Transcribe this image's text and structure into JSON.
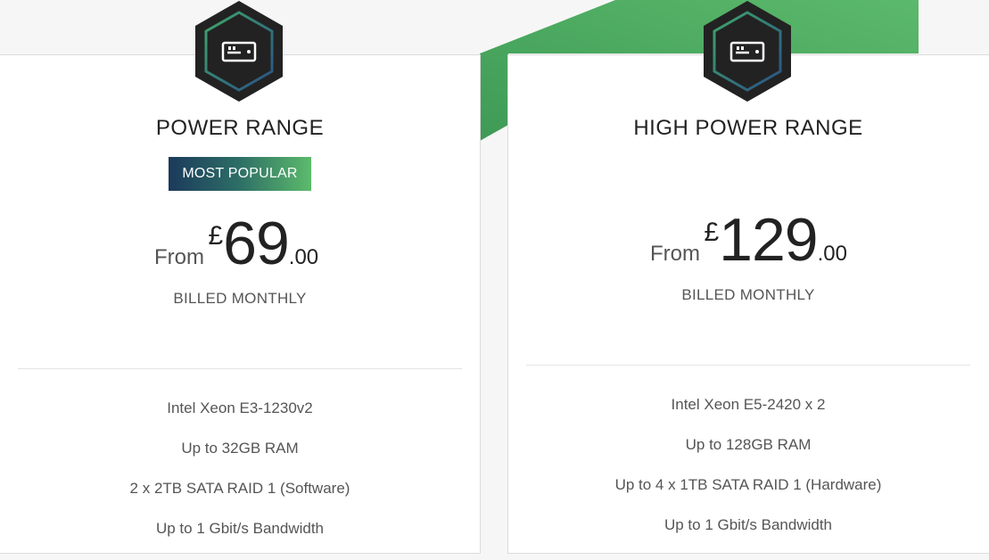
{
  "colors": {
    "accent_green": "#4caa5f",
    "dark_navy": "#1b3a5c",
    "hex_fill": "#222222"
  },
  "plans": [
    {
      "icon": "server-icon",
      "title": "POWER RANGE",
      "badge": "MOST POPULAR",
      "from_label": "From",
      "currency": "£",
      "amount": "69",
      "cents": ".00",
      "billing": "BILLED MONTHLY",
      "features": [
        "Intel Xeon E3-1230v2",
        "Up to 32GB RAM",
        "2 x 2TB SATA RAID 1 (Software)",
        "Up to 1 Gbit/s Bandwidth"
      ]
    },
    {
      "icon": "server-icon",
      "title": "HIGH POWER RANGE",
      "from_label": "From",
      "currency": "£",
      "amount": "129",
      "cents": ".00",
      "billing": "BILLED MONTHLY",
      "features": [
        "Intel Xeon E5-2420 x 2",
        "Up to 128GB RAM",
        "Up to 4 x 1TB SATA RAID 1 (Hardware)",
        "Up to 1 Gbit/s Bandwidth"
      ]
    }
  ]
}
